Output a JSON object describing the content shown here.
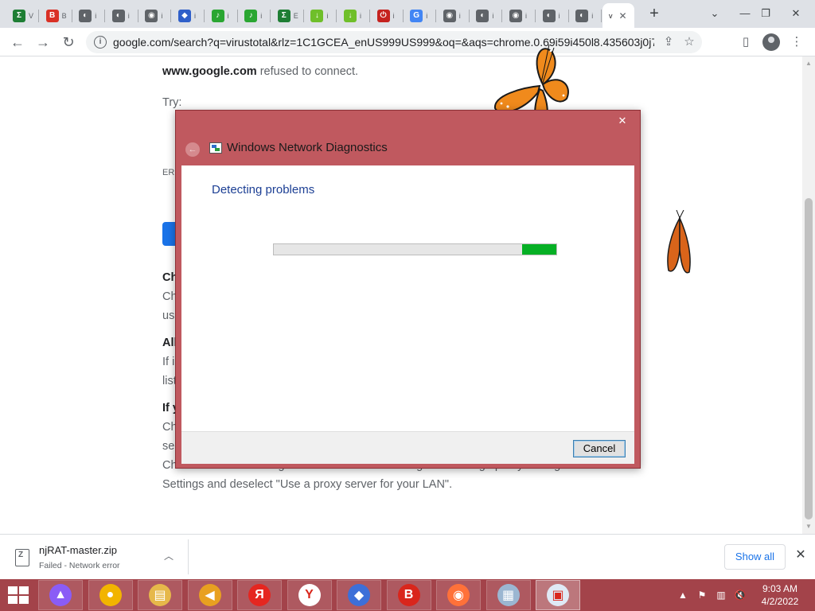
{
  "browser": {
    "tabs": [
      {
        "letter": "Σ",
        "color": "#1e7e34",
        "text": "V"
      },
      {
        "letter": "B",
        "color": "#d93025",
        "text": "B"
      },
      {
        "letter": "◐",
        "color": "#5f6368",
        "text": "i"
      },
      {
        "letter": "◐",
        "color": "#5f6368",
        "text": "i"
      },
      {
        "letter": "◉",
        "color": "#5f6368",
        "text": "i"
      },
      {
        "letter": "◆",
        "color": "#2f5fc9",
        "text": "i"
      },
      {
        "letter": "♪",
        "color": "#2aa632",
        "text": "i"
      },
      {
        "letter": "♪",
        "color": "#2aa632",
        "text": "i"
      },
      {
        "letter": "Σ",
        "color": "#1e7e34",
        "text": "E"
      },
      {
        "letter": "↓",
        "color": "#6fbf2a",
        "text": "i"
      },
      {
        "letter": "↓",
        "color": "#6fbf2a",
        "text": "i"
      },
      {
        "letter": "⏻",
        "color": "#c5221f",
        "text": "i"
      },
      {
        "letter": "G",
        "color": "#4285f4",
        "text": "i"
      },
      {
        "letter": "◉",
        "color": "#5f6368",
        "text": "i"
      },
      {
        "letter": "◐",
        "color": "#5f6368",
        "text": "i"
      },
      {
        "letter": "◉",
        "color": "#5f6368",
        "text": "i"
      },
      {
        "letter": "◐",
        "color": "#5f6368",
        "text": "i"
      },
      {
        "letter": "◐",
        "color": "#5f6368",
        "text": "i"
      }
    ],
    "active_tab": {
      "text": "v",
      "close": "✕"
    },
    "new_tab": "+",
    "window_controls": {
      "dropdown": "⌄",
      "minimize": "—",
      "restore": "❐",
      "close": "✕"
    },
    "nav": {
      "back": "←",
      "forward": "→",
      "reload": "↻"
    },
    "url": "google.com/search?q=virustotal&rlz=1C1GCEA_enUS999US999&oq=&aqs=chrome.0.69i59i450l8.435603j0j7&s...",
    "url_info": "i",
    "share_icon": "⇪",
    "star_icon": "☆",
    "sidepanel_icon": "▯",
    "menu_icon": "⋮"
  },
  "page": {
    "refused_host": "www.google.com",
    "refused_text": " refused to connect.",
    "try": "Try:",
    "err_code": "ERR",
    "frag1_bold": "Ch",
    "frag1a": "Ch",
    "frag1b": "us",
    "frag2_bold": "All",
    "frag2a": "If i",
    "frag2b": "list",
    "frag3_bold": "If y",
    "frag3a": "Ch",
    "frag3b": "se",
    "frag3c": "Chrome menu > Settings > Show advanced settings... > Change proxy settings... > LAN",
    "frag3d": "Settings and deselect \"Use a proxy server for your LAN\"."
  },
  "dialog": {
    "title": "Windows Network Diagnostics",
    "close": "✕",
    "back": "←",
    "heading": "Detecting problems",
    "progress_fraction": 0.88,
    "cancel_label": "Cancel"
  },
  "downloads": {
    "file_name": "njRAT-master.zip",
    "status": "Failed - Network error",
    "chevron": "︿",
    "show_all": "Show all",
    "close": "✕"
  },
  "taskbar": {
    "apps": [
      {
        "name": "alice-icon",
        "glyph": "▲",
        "color": "#8a5cf6",
        "open": false
      },
      {
        "name": "chrome-icon",
        "glyph": "●",
        "color": "#f2b400",
        "open": false
      },
      {
        "name": "file-explorer-icon",
        "glyph": "▤",
        "color": "#e6b84a",
        "open": false
      },
      {
        "name": "megaphone-icon",
        "glyph": "◀",
        "color": "#e8a020",
        "open": false
      },
      {
        "name": "yandex-icon",
        "glyph": "Я",
        "color": "#e52620",
        "open": false
      },
      {
        "name": "yandex-browser-icon",
        "glyph": "Y",
        "color": "#ffffff",
        "open": false
      },
      {
        "name": "drop-app-icon",
        "glyph": "◆",
        "color": "#3d6fd8",
        "open": false
      },
      {
        "name": "b-browser-icon",
        "glyph": "B",
        "color": "#d9261c",
        "open": false
      },
      {
        "name": "firefox-icon",
        "glyph": "◉",
        "color": "#ff7139",
        "open": false
      },
      {
        "name": "performance-monitor-icon",
        "glyph": "▦",
        "color": "#9bb6d1",
        "open": false
      },
      {
        "name": "network-diagnostics-icon",
        "glyph": "▣",
        "color": "#dfe9f5",
        "open": true
      }
    ],
    "tray": {
      "chevron": "▲",
      "flag": "⚑",
      "network": "▥",
      "volume": "🔇"
    },
    "time": "9:03 AM",
    "date": "4/2/2022"
  }
}
